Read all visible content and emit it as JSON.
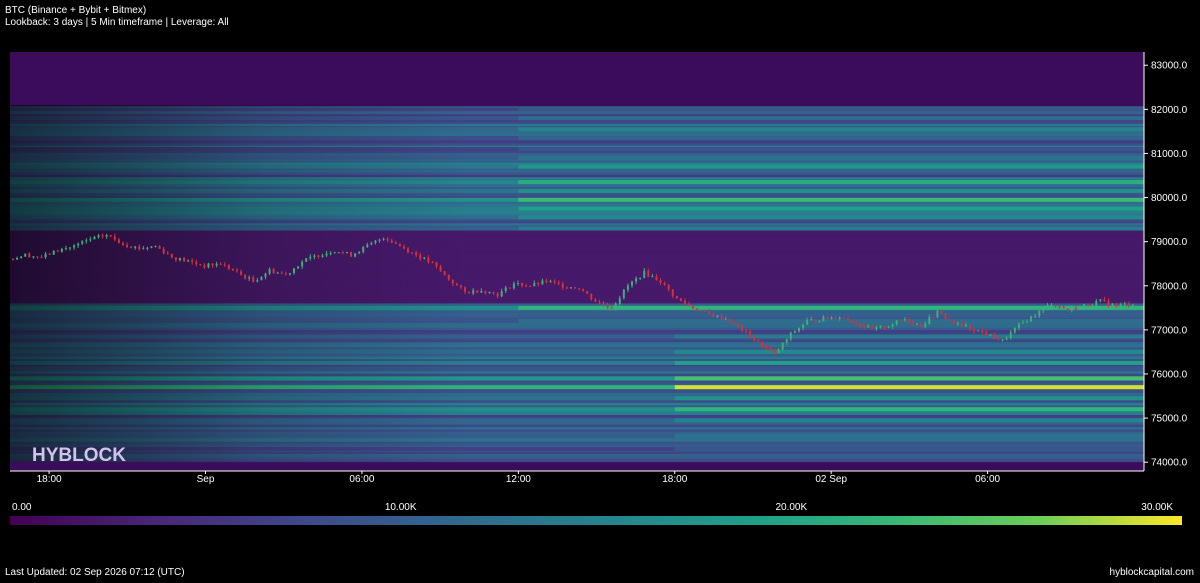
{
  "header": {
    "title": "BTC (Binance + Bybit + Bitmex)",
    "subtitle": "Lookback: 3 days | 5 Min timeframe | Leverage: All"
  },
  "watermark": "HYBLOCK",
  "footer": {
    "updated": "Last Updated: 02 Sep 2026 07:12 (UTC)",
    "site": "hyblockcapital.com"
  },
  "colors": {
    "background": "#000000",
    "heat_low": "#440154",
    "heat_mid": "#21918c",
    "heat_high": "#fde725",
    "candle_up": "#3fae7a",
    "candle_down": "#d6313d"
  },
  "chart_data": {
    "type": "heatmap",
    "overlay": "candlestick",
    "y_ticks": [
      "74000.0",
      "75000.0",
      "76000.0",
      "77000.0",
      "78000.0",
      "79000.0",
      "80000.0",
      "81000.0",
      "82000.0",
      "83000.0"
    ],
    "y_range": [
      73800,
      83300
    ],
    "x_ticks": [
      "18:00",
      "Sep",
      "06:00",
      "12:00",
      "18:00",
      "02 Sep",
      "06:00"
    ],
    "x_range_hours": [
      -7.5,
      36
    ],
    "x_tick_hours": [
      -6,
      0,
      6,
      12,
      18,
      24,
      30
    ],
    "colorbar": {
      "min": 0,
      "max": 30000,
      "ticks": [
        "0.00",
        "10.00K",
        "20.00K",
        "30.00K"
      ],
      "tick_values": [
        0,
        10000,
        20000,
        30000
      ]
    },
    "price_path": [
      [
        -7.5,
        78600
      ],
      [
        -7,
        78700
      ],
      [
        -6.5,
        78650
      ],
      [
        -6,
        78800
      ],
      [
        -5,
        78900
      ],
      [
        -4,
        79050
      ],
      [
        -3,
        79150
      ],
      [
        -2,
        78950
      ],
      [
        -1,
        78850
      ],
      [
        0,
        78900
      ],
      [
        1,
        78650
      ],
      [
        2,
        78550
      ],
      [
        3,
        78450
      ],
      [
        4,
        78500
      ],
      [
        5,
        78300
      ],
      [
        6,
        78100
      ],
      [
        7,
        78350
      ],
      [
        8,
        78250
      ],
      [
        9,
        78550
      ],
      [
        10,
        78700
      ],
      [
        11,
        78800
      ],
      [
        12,
        78700
      ],
      [
        13,
        78900
      ],
      [
        14,
        79100
      ],
      [
        15,
        78900
      ],
      [
        16,
        78700
      ],
      [
        17,
        78500
      ],
      [
        18,
        78150
      ],
      [
        19,
        77850
      ],
      [
        20,
        77900
      ],
      [
        21,
        77800
      ],
      [
        22,
        78050
      ],
      [
        23,
        78000
      ],
      [
        24,
        78100
      ],
      [
        25,
        78000
      ],
      [
        26,
        77950
      ],
      [
        27,
        77650
      ],
      [
        28,
        77500
      ],
      [
        29,
        78000
      ],
      [
        30,
        78300
      ],
      [
        31,
        78100
      ],
      [
        32,
        77700
      ],
      [
        33,
        77500
      ],
      [
        34,
        77350
      ],
      [
        35,
        77250
      ],
      [
        36,
        77000
      ],
      [
        37,
        76700
      ],
      [
        38,
        76450
      ],
      [
        39,
        76900
      ],
      [
        40,
        77200
      ],
      [
        41,
        77250
      ],
      [
        42,
        77300
      ],
      [
        43,
        77150
      ],
      [
        44,
        77000
      ],
      [
        45,
        77100
      ],
      [
        46,
        77250
      ],
      [
        47,
        77100
      ],
      [
        48,
        77400
      ],
      [
        49,
        77150
      ],
      [
        50,
        77050
      ],
      [
        51,
        76900
      ],
      [
        52,
        76750
      ],
      [
        53,
        77100
      ],
      [
        54,
        77350
      ],
      [
        55,
        77600
      ],
      [
        56,
        77450
      ],
      [
        57,
        77550
      ],
      [
        58,
        77650
      ],
      [
        59,
        77550
      ],
      [
        60,
        77600
      ]
    ],
    "liquidity_levels": [
      {
        "price": 82000,
        "value": 9000
      },
      {
        "price": 81800,
        "value": 12000
      },
      {
        "price": 81550,
        "value": 15000
      },
      {
        "price": 81350,
        "value": 11000
      },
      {
        "price": 81100,
        "value": 9000
      },
      {
        "price": 80900,
        "value": 13000
      },
      {
        "price": 80700,
        "value": 18000
      },
      {
        "price": 80350,
        "value": 21000
      },
      {
        "price": 80150,
        "value": 17000
      },
      {
        "price": 79950,
        "value": 23000
      },
      {
        "price": 79750,
        "value": 19000
      },
      {
        "price": 79550,
        "value": 16000
      },
      {
        "price": 79300,
        "value": 14000
      },
      {
        "price": 77500,
        "value": 22000
      },
      {
        "price": 77200,
        "value": 12000
      },
      {
        "price": 76850,
        "value": 14000
      },
      {
        "price": 76500,
        "value": 16000
      },
      {
        "price": 76250,
        "value": 19000
      },
      {
        "price": 75900,
        "value": 24000
      },
      {
        "price": 75700,
        "value": 29000
      },
      {
        "price": 75450,
        "value": 17000
      },
      {
        "price": 75200,
        "value": 22000
      },
      {
        "price": 74950,
        "value": 15000
      },
      {
        "price": 74600,
        "value": 13000
      },
      {
        "price": 74300,
        "value": 9000
      }
    ]
  }
}
